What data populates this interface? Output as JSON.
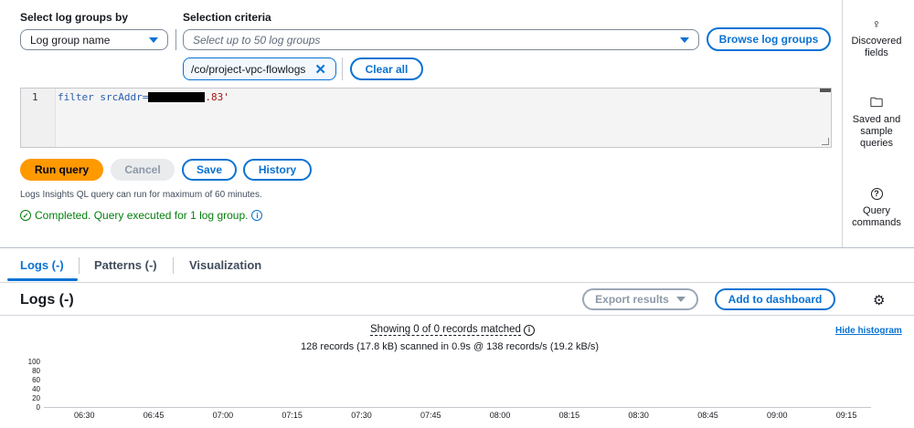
{
  "query_panel": {
    "select_by_label": "Select log groups by",
    "select_by_value": "Log group name",
    "criteria_label": "Selection criteria",
    "criteria_placeholder": "Select up to 50 log groups",
    "browse_button": "Browse log groups",
    "selected_group": "/co/project-vpc-flowlogs",
    "clear_all": "Clear all",
    "editor": {
      "line_number": "1",
      "query_prefix": "filter srcAddr=",
      "query_suffix": ".83'"
    },
    "run_query": "Run query",
    "cancel": "Cancel",
    "save": "Save",
    "history": "History",
    "hint": "Logs Insights QL query can run for maximum of 60 minutes.",
    "status": "Completed. Query executed for 1 log group."
  },
  "side_panel": {
    "discovered_fields": [
      "Discovered",
      "fields"
    ],
    "saved_queries": [
      "Saved and",
      "sample",
      "queries"
    ],
    "query_commands": [
      "Query",
      "commands"
    ]
  },
  "tabs": [
    {
      "label": "Logs (-)",
      "active": true
    },
    {
      "label": "Patterns (-)",
      "active": false
    },
    {
      "label": "Visualization",
      "active": false
    }
  ],
  "results": {
    "title": "Logs (-)",
    "export_results": "Export results",
    "add_to_dashboard": "Add to dashboard",
    "showing_text": "Showing 0 of 0 records matched",
    "scan_text": "128 records (17.8 kB) scanned in 0.9s @ 138 records/s (19.2 kB/s)",
    "hide_histogram": "Hide histogram"
  },
  "chart_data": {
    "type": "bar",
    "x_ticks": [
      "06:30",
      "06:45",
      "07:00",
      "07:15",
      "07:30",
      "07:45",
      "08:00",
      "08:15",
      "08:30",
      "08:45",
      "09:00",
      "09:15"
    ],
    "y_ticks": [
      "100",
      "80",
      "60",
      "40",
      "20",
      "0"
    ],
    "ylim": [
      0,
      100
    ],
    "values": []
  },
  "colors": {
    "accent": "#0972d3",
    "primary_button": "#ff9900",
    "success": "#037f0c"
  }
}
